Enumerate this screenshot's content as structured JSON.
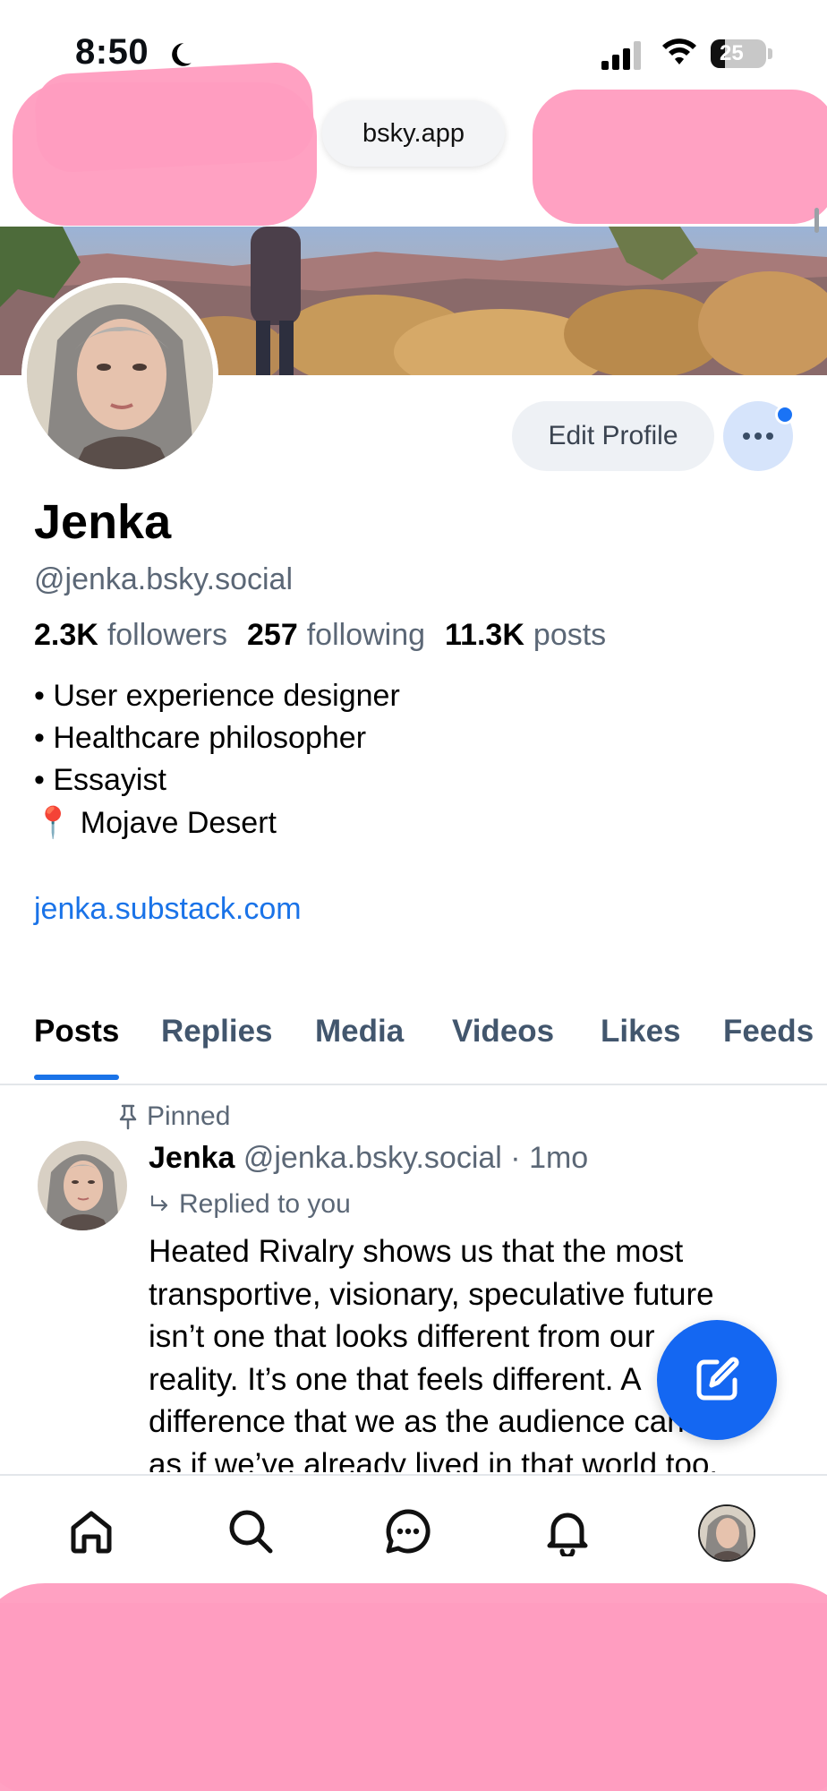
{
  "status_bar": {
    "time": "8:50",
    "battery": "25"
  },
  "browser": {
    "url": "bsky.app"
  },
  "profile": {
    "display_name": "Jenka",
    "handle": "@jenka.bsky.social",
    "edit_label": "Edit Profile",
    "stats": {
      "followers_count": "2.3K",
      "followers_label": "followers",
      "following_count": "257",
      "following_label": "following",
      "posts_count": "11.3K",
      "posts_label": "posts"
    },
    "bio": [
      "• User experience designer",
      "• Healthcare philosopher",
      "• Essayist",
      "📍 Mojave Desert"
    ],
    "link": "jenka.substack.com"
  },
  "tabs": [
    "Posts",
    "Replies",
    "Media",
    "Videos",
    "Likes",
    "Feeds"
  ],
  "active_tab": "Posts",
  "post": {
    "pinned_label": "Pinned",
    "author": "Jenka",
    "handle_time": "@jenka.bsky.social · 1mo",
    "reply_context": "Replied to you",
    "text_lines": [
      "Heated Rivalry shows us that the most",
      "transportive, visionary, speculative future",
      "isn’t one that looks different from our",
      "reality. It’s one that feels different. A",
      "difference that we as the audience can feel",
      "as if we’ve already lived in that world too."
    ]
  },
  "colors": {
    "accent": "#1a73e8",
    "fab": "#1467f2",
    "redaction": "#ff9dbf",
    "muted_text": "#5b6776"
  },
  "icons": {
    "nav": [
      "home-icon",
      "search-icon",
      "chat-icon",
      "bell-icon",
      "avatar"
    ],
    "fab": "compose-icon"
  }
}
